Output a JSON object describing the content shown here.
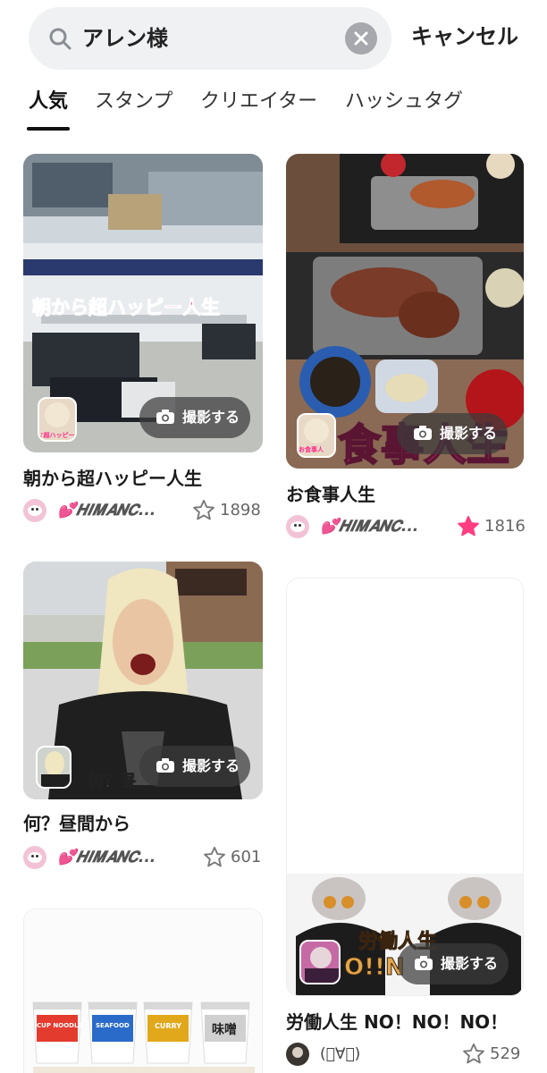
{
  "search": {
    "query": "アレン様",
    "cancel_label": "キャンセル"
  },
  "tabs": [
    {
      "label": "人気",
      "active": true
    },
    {
      "label": "スタンプ",
      "active": false
    },
    {
      "label": "クリエイター",
      "active": false
    },
    {
      "label": "ハッシュタグ",
      "active": false
    }
  ],
  "cards": [
    {
      "title": "朝から超ハッピー人生",
      "overlay": "朝から超ハッピー人生",
      "avatar_label": "♪超ハッピー",
      "shoot_label": "撮影する",
      "user": "💕𝑯𝑰𝑴𝑨𝑵𝑪...",
      "favorites": "1898",
      "favorited": false
    },
    {
      "title": "お食事人生",
      "overlay": "食事人生",
      "avatar_label": "お食事人",
      "shoot_label": "撮影する",
      "user": "💕𝑯𝑰𝑴𝑨𝑵𝑪...",
      "favorites": "1816",
      "favorited": true
    },
    {
      "title": "何？昼間から",
      "overlay": "何？昼",
      "shoot_label": "撮影する",
      "user": "💕𝑯𝑰𝑴𝑨𝑵𝑪...",
      "favorites": "601",
      "favorited": false
    },
    {
      "title": "労働人生 NO！NO！NO！",
      "overlay": "労働人生",
      "overlay2": "O!!N",
      "shoot_label": "撮影する",
      "user": "(ﾟ∀ﾟ)",
      "favorites": "529",
      "favorited": false
    },
    {
      "cups": [
        "CUP NOODLE",
        "SEAFOOD",
        "CURRY",
        "味噌"
      ]
    }
  ],
  "colors": {
    "accent_pink": "#ff3d7f",
    "overlay_pink": "#ff2d8a"
  }
}
